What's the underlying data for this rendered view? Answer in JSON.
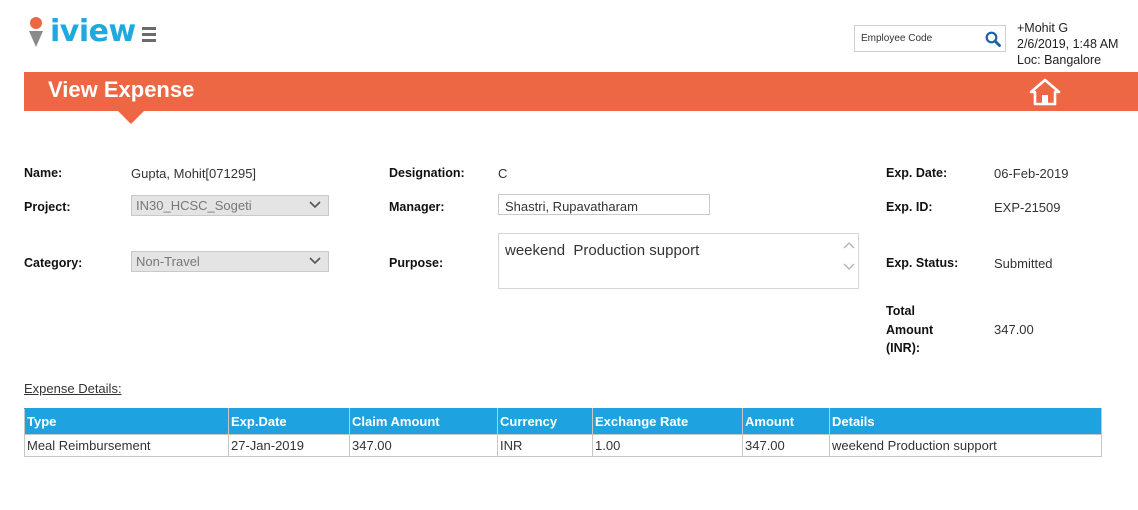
{
  "header": {
    "logo_text": "iview",
    "employee_code_placeholder": "Employee Code",
    "user_name": "+Mohit G",
    "datetime": "2/6/2019, 1:48 AM",
    "location": "Loc: Bangalore"
  },
  "banner": {
    "title": "View Expense"
  },
  "form": {
    "name_label": "Name:",
    "name_value": "Gupta, Mohit[071295]",
    "project_label": "Project:",
    "project_value": "IN30_HCSC_Sogeti",
    "category_label": "Category:",
    "category_value": "Non-Travel",
    "designation_label": "Designation:",
    "designation_value": "C",
    "manager_label": "Manager:",
    "manager_value": "Shastri, Rupavatharam",
    "purpose_label": "Purpose:",
    "purpose_value": "weekend  Production support",
    "exp_date_label": "Exp. Date:",
    "exp_date_value": "06-Feb-2019",
    "exp_id_label": "Exp. ID:",
    "exp_id_value": "EXP-21509",
    "exp_status_label": "Exp. Status:",
    "exp_status_value": "Submitted",
    "total_label_line1": "Total",
    "total_label_line2": "Amount",
    "total_label_line3": "(INR):",
    "total_value": "347.00"
  },
  "details": {
    "section_title": "Expense Details:",
    "columns": [
      "Type",
      "Exp.Date",
      "Claim Amount",
      "Currency",
      "Exchange Rate",
      "Amount",
      "Details"
    ],
    "rows": [
      [
        "Meal Reimbursement",
        "27-Jan-2019",
        "347.00",
        "INR",
        "1.00",
        "347.00",
        "weekend Production support"
      ]
    ]
  },
  "colors": {
    "accent_orange": "#ee6744",
    "brand_blue": "#1fa9dc",
    "table_header_blue": "#1fa3e0"
  },
  "icons": {
    "search": "search-icon",
    "menu": "hamburger-menu-icon",
    "home": "home-icon",
    "dropdown": "chevron-down-icon"
  }
}
